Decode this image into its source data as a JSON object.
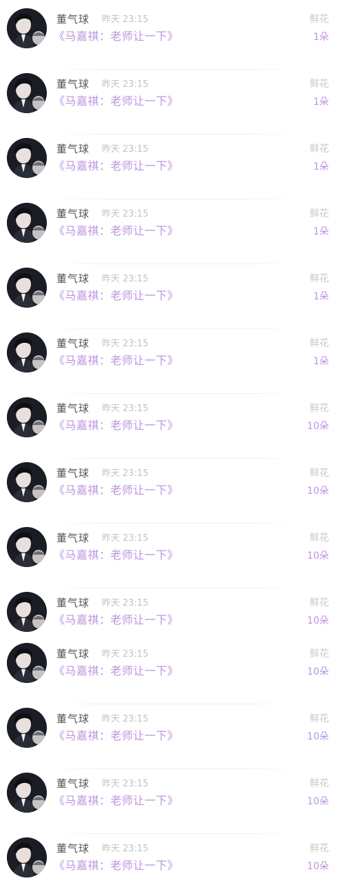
{
  "gift_records": [
    {
      "sender": "董气球",
      "time": "昨天 23:15",
      "title": "《马嘉祺：老师让一下》",
      "gift": "鲜花",
      "count": "1朵",
      "avatar_icon": "user-avatar-icon"
    },
    {
      "sender": "董气球",
      "time": "昨天 23:15",
      "title": "《马嘉祺：老师让一下》",
      "gift": "鲜花",
      "count": "1朵",
      "avatar_icon": "user-avatar-icon"
    },
    {
      "sender": "董气球",
      "time": "昨天 23:15",
      "title": "《马嘉祺：老师让一下》",
      "gift": "鲜花",
      "count": "1朵",
      "avatar_icon": "user-avatar-icon"
    },
    {
      "sender": "董气球",
      "time": "昨天 23:15",
      "title": "《马嘉祺：老师让一下》",
      "gift": "鲜花",
      "count": "1朵",
      "avatar_icon": "user-avatar-icon"
    },
    {
      "sender": "董气球",
      "time": "昨天 23:15",
      "title": "《马嘉祺：老师让一下》",
      "gift": "鲜花",
      "count": "1朵",
      "avatar_icon": "user-avatar-icon"
    },
    {
      "sender": "董气球",
      "time": "昨天 23:15",
      "title": "《马嘉祺：老师让一下》",
      "gift": "鲜花",
      "count": "1朵",
      "avatar_icon": "user-avatar-icon"
    },
    {
      "sender": "董气球",
      "time": "昨天 23:15",
      "title": "《马嘉祺：老师让一下》",
      "gift": "鲜花",
      "count": "10朵",
      "avatar_icon": "user-avatar-icon"
    },
    {
      "sender": "董气球",
      "time": "昨天 23:15",
      "title": "《马嘉祺：老师让一下》",
      "gift": "鲜花",
      "count": "10朵",
      "avatar_icon": "user-avatar-icon"
    },
    {
      "sender": "董气球",
      "time": "昨天 23:15",
      "title": "《马嘉祺：老师让一下》",
      "gift": "鲜花",
      "count": "10朵",
      "avatar_icon": "user-avatar-icon"
    },
    {
      "sender": "董气球",
      "time": "昨天 23:15",
      "title": "《马嘉祺：老师让一下》",
      "gift": "鲜花",
      "count": "10朵",
      "avatar_icon": "user-avatar-icon"
    },
    {
      "sender": "董气球",
      "time": "昨天 23:15",
      "title": "《马嘉祺：老师让一下》",
      "gift": "鲜花",
      "count": "10朵",
      "avatar_icon": "user-avatar-icon"
    },
    {
      "sender": "董气球",
      "time": "昨天 23:15",
      "title": "《马嘉祺：老师让一下》",
      "gift": "鲜花",
      "count": "10朵",
      "avatar_icon": "user-avatar-icon"
    },
    {
      "sender": "董气球",
      "time": "昨天 23:15",
      "title": "《马嘉祺：老师让一下》",
      "gift": "鲜花",
      "count": "10朵",
      "avatar_icon": "user-avatar-icon"
    },
    {
      "sender": "董气球",
      "time": "昨天 23:15",
      "title": "《马嘉祺：老师让一下》",
      "gift": "鲜花",
      "count": "10朵",
      "avatar_icon": "user-avatar-icon"
    }
  ],
  "colors": {
    "name": "#555555",
    "time": "#c2c2c2",
    "accent": "#bb94df",
    "gift_label": "#c8c8c8"
  }
}
